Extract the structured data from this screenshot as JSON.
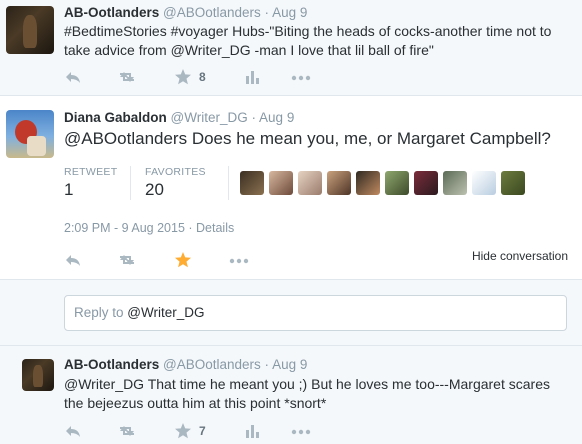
{
  "tweets": [
    {
      "name": "AB-Ootlanders",
      "handle": "@ABOotlanders",
      "dot": "·",
      "time": "Aug 9",
      "text_line1": "#BedtimeStories #voyager Hubs-\"Biting the heads of cocks-another time not to",
      "text_line2": "take advice from @Writer_DG -man I love that lil ball of fire\"",
      "favorites": "8"
    },
    {
      "name": "Diana Gabaldon",
      "handle": "@Writer_DG",
      "dot": "·",
      "time": "Aug 9",
      "text": "@ABOotlanders Does he mean you, me, or Margaret Campbell?",
      "retweet_label": "RETWEET",
      "retweet_count": "1",
      "favorites_label": "FAVORITES",
      "favorites_count": "20",
      "timestamp": "2:09 PM - 9 Aug 2015 · Details",
      "favorited": true
    },
    {
      "name": "AB-Ootlanders",
      "handle": "@ABOotlanders",
      "dot": "·",
      "time": "Aug 9",
      "text_line1": "@Writer_DG That time he meant you ;) But he loves me too---Margaret scares",
      "text_line2": "the bejeezus outta him at this point *snort*",
      "favorites": "7"
    }
  ],
  "hide_conversation": "Hide conversation",
  "reply": {
    "prefix": "Reply to",
    "mention": "@Writer_DG"
  },
  "colors": {
    "favorite_active": "#ffac33",
    "icon_gray": "#aab8c2",
    "background_gray": "#f5f8fa",
    "border": "#e1e8ed"
  },
  "icons": [
    "reply-icon",
    "retweet-icon",
    "favorite-star-icon",
    "stats-icon",
    "more-icon"
  ]
}
